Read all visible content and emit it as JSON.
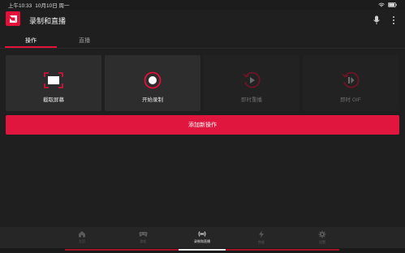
{
  "statusbar": {
    "time": "上午10:33",
    "date": "10月10日 周一"
  },
  "app": {
    "title": "录制和直播"
  },
  "tabs": [
    {
      "label": "操作",
      "active": true
    },
    {
      "label": "直播",
      "active": false
    }
  ],
  "actions": [
    {
      "label": "截取屏幕",
      "icon": "screenshot-icon",
      "enabled": true
    },
    {
      "label": "开始录制",
      "icon": "record-icon",
      "enabled": true
    },
    {
      "label": "即时重播",
      "icon": "instant-replay-icon",
      "enabled": false
    },
    {
      "label": "即时 GIF",
      "icon": "instant-gif-icon",
      "enabled": false
    }
  ],
  "add_button": {
    "label": "添加新操作"
  },
  "bottom_nav": [
    {
      "label": "主页",
      "icon": "home-icon",
      "active": false
    },
    {
      "label": "游戏",
      "icon": "gamepad-icon",
      "active": false
    },
    {
      "label": "录制和直播",
      "icon": "broadcast-icon",
      "active": true
    },
    {
      "label": "性能",
      "icon": "lightning-icon",
      "active": false
    },
    {
      "label": "设置",
      "icon": "gear-icon",
      "active": false
    }
  ],
  "colors": {
    "accent": "#e3103a",
    "background": "#1f1f1f",
    "card": "#2d2d2d"
  }
}
